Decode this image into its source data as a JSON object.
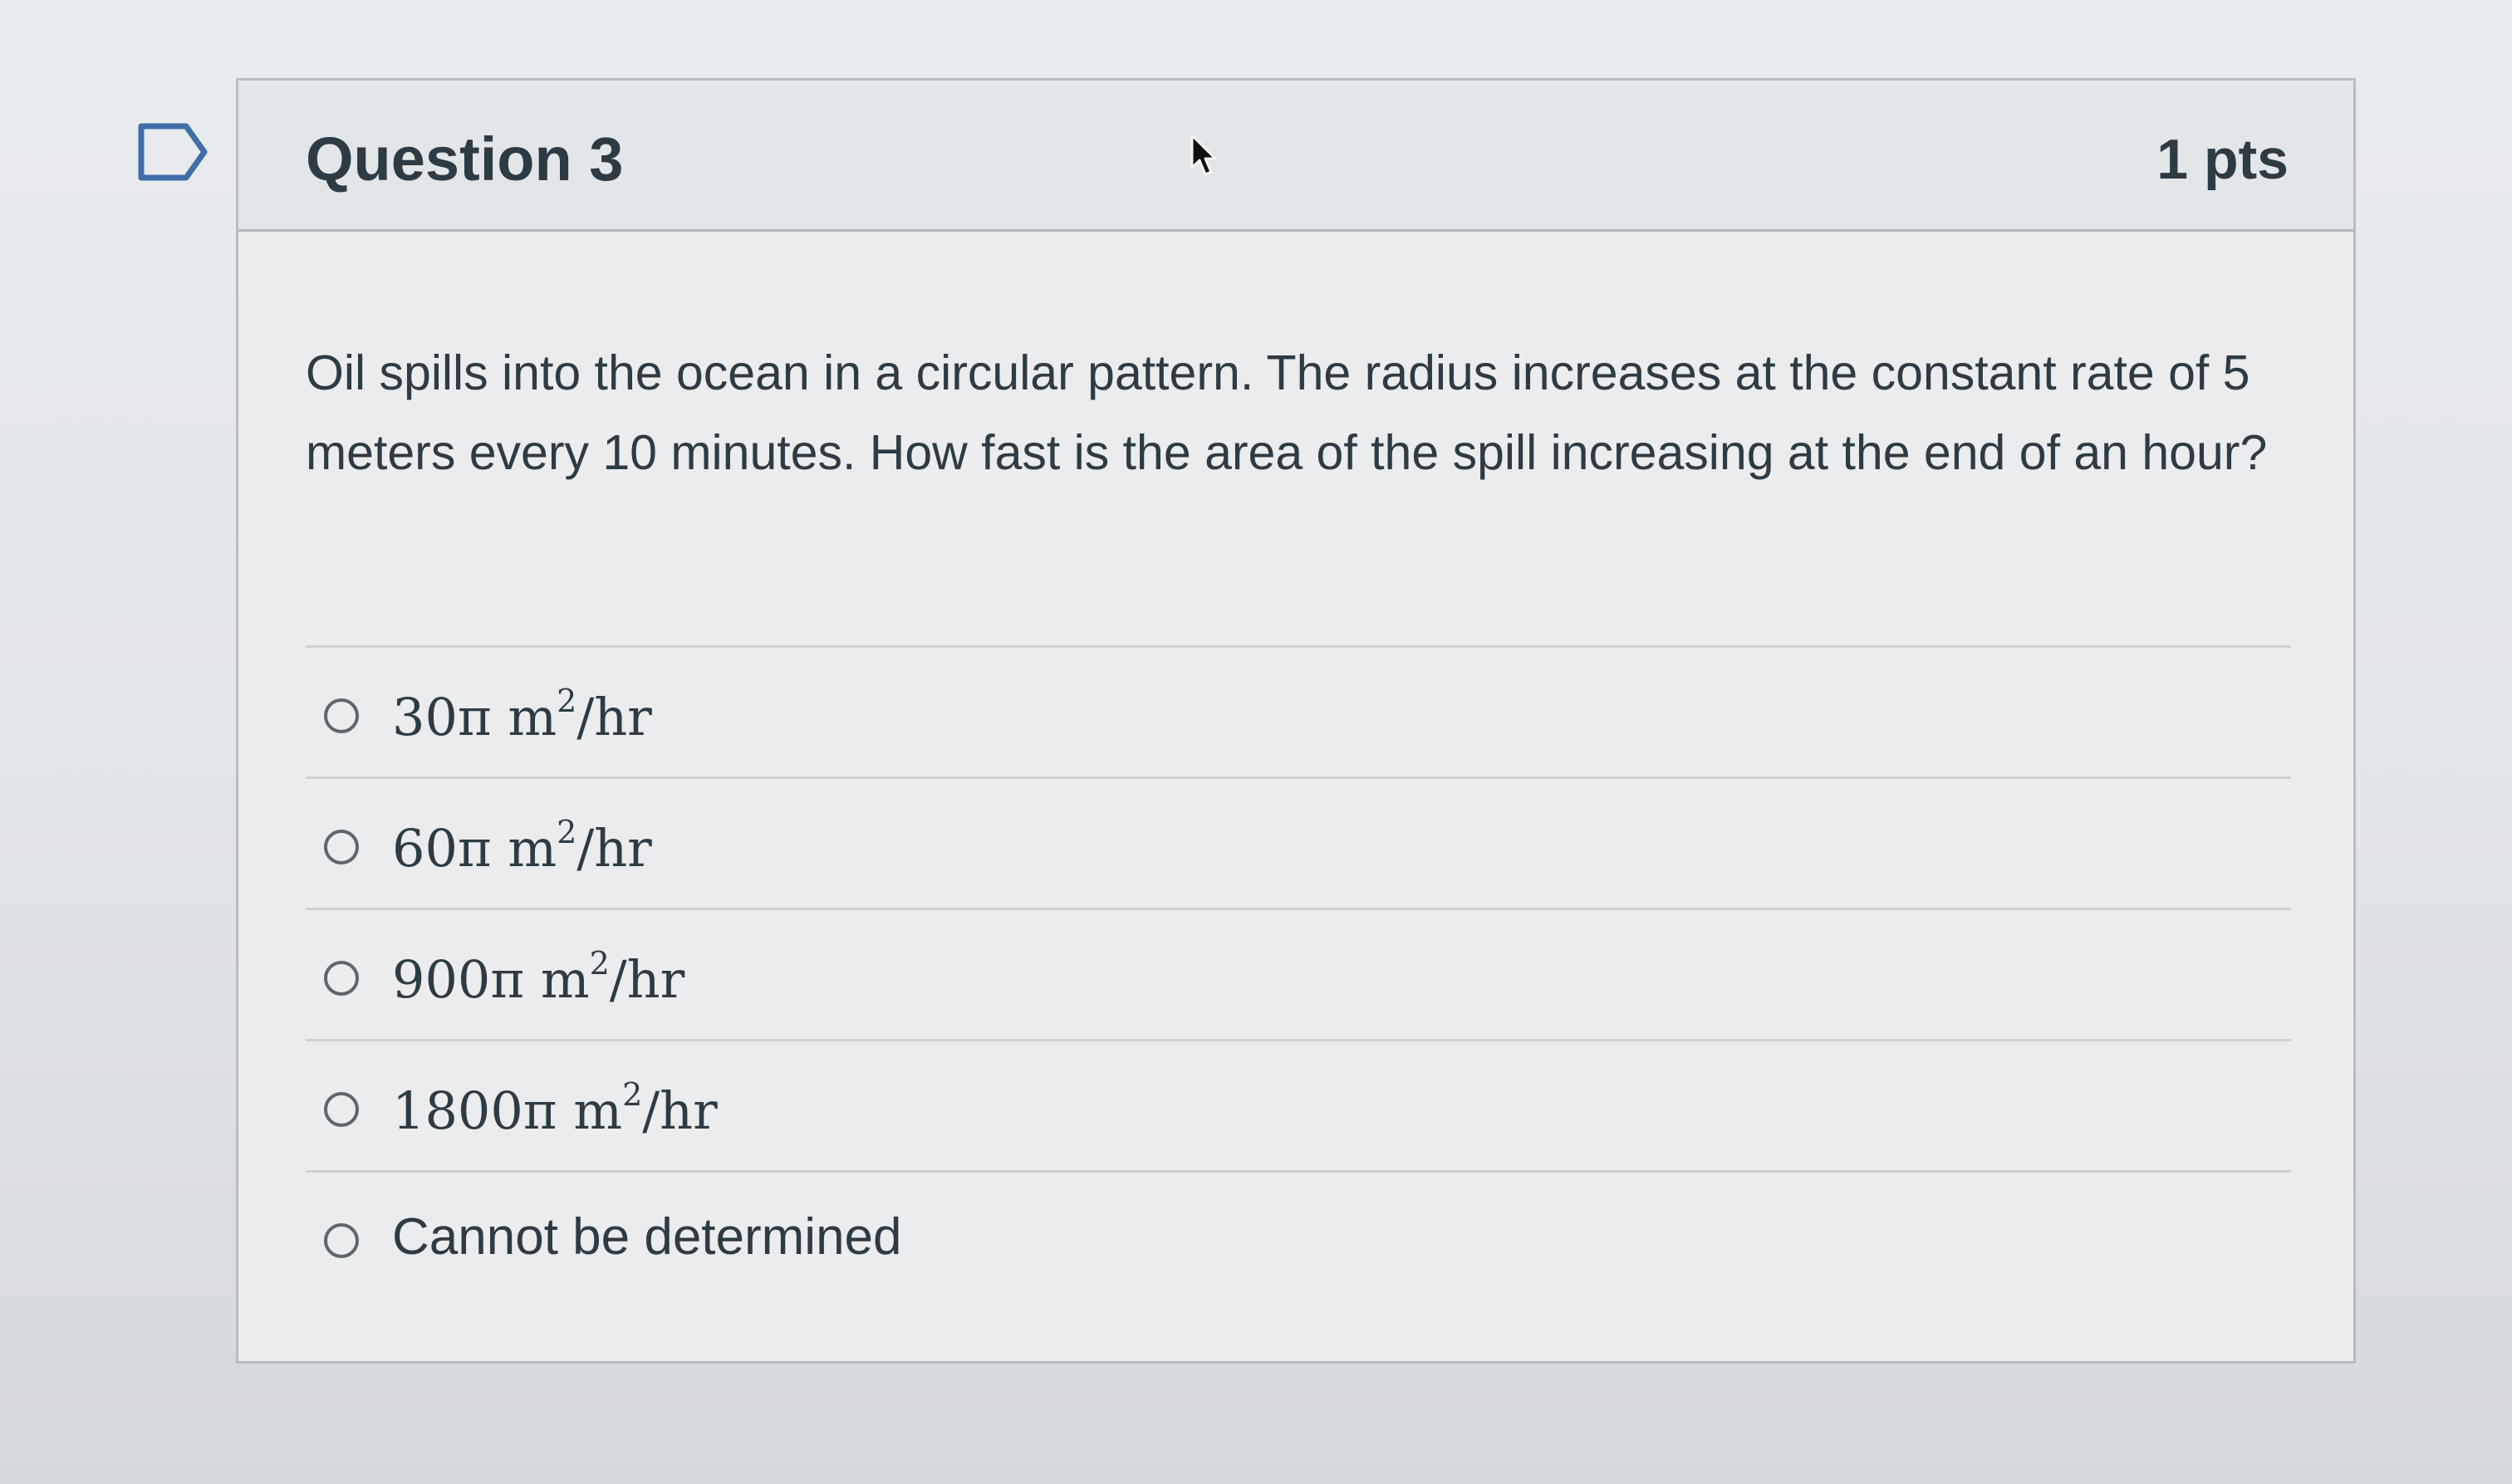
{
  "question": {
    "title": "Question 3",
    "points": "1 pts",
    "text": "Oil spills into the ocean in a circular pattern. The radius increases at the constant rate of 5 meters every 10 minutes. How fast is the area of the spill increasing at the end of an hour?"
  },
  "answers": [
    {
      "value": "30π",
      "unit": "m",
      "exponent": "2",
      "per": "/hr",
      "selected": false
    },
    {
      "value": "60π",
      "unit": "m",
      "exponent": "2",
      "per": "/hr",
      "selected": false
    },
    {
      "value": "900π",
      "unit": "m",
      "exponent": "2",
      "per": "/hr",
      "selected": false
    },
    {
      "value": "1800π",
      "unit": "m",
      "exponent": "2",
      "per": "/hr",
      "selected": false
    },
    {
      "text": "Cannot be determined",
      "selected": false
    }
  ],
  "icons": {
    "flag": "flag-outline-icon",
    "cursor": "mouse-pointer-icon"
  },
  "colors": {
    "text": "#2d3b45",
    "border": "#b9bdc1",
    "header_bg": "#e3e6e8",
    "radio": "#5d666d"
  }
}
